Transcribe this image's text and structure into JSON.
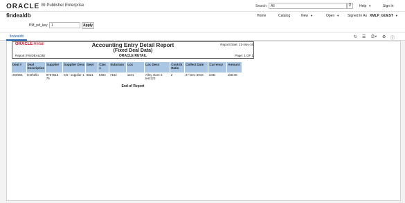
{
  "header": {
    "logo_text": "ORACLE",
    "product": "BI Publisher Enterprise",
    "search_label": "Search",
    "search_value": "All",
    "help": "Help",
    "sign_out": "Sign In"
  },
  "menubar": {
    "page_title": "findealdb",
    "home": "Home",
    "catalog": "Catalog",
    "new": "New",
    "open": "Open",
    "signed_in_as": "Signed In As",
    "user": "XMLP_GUEST"
  },
  "params": {
    "label": "PM_ref_key",
    "value": "1",
    "apply": "Apply"
  },
  "tabs": {
    "active": "findealdb"
  },
  "report": {
    "logo_oracle": "ORACLE",
    "logo_retail": "Retail",
    "title": "Accounting Entry Detail Report",
    "subtitle": "(Fixed Deal Data)",
    "org": "ORACLE RETAIL",
    "report_date": "Report Date: 21-Nov-16",
    "report_id": "Report (FINDEALDB)",
    "page": "Page: 1 OF 1",
    "end_of_report": "End of Report",
    "columns": [
      "Deal #",
      "Deal Description",
      "Supplier",
      "Supplier Desc",
      "Dept",
      "Clas s",
      "Subclass",
      "Loc",
      "Loc Desc",
      "Contrib Ratio",
      "Collect Date",
      "Currency",
      "Amount"
    ],
    "rows": [
      [
        "250001",
        "testhello",
        "9767613 75",
        "SN - supplier 1",
        "5821",
        "6494",
        "7162",
        "1101",
        "Alley store 2 test123",
        "2",
        "27-Dec-2016",
        "USD",
        "169.00"
      ]
    ]
  }
}
